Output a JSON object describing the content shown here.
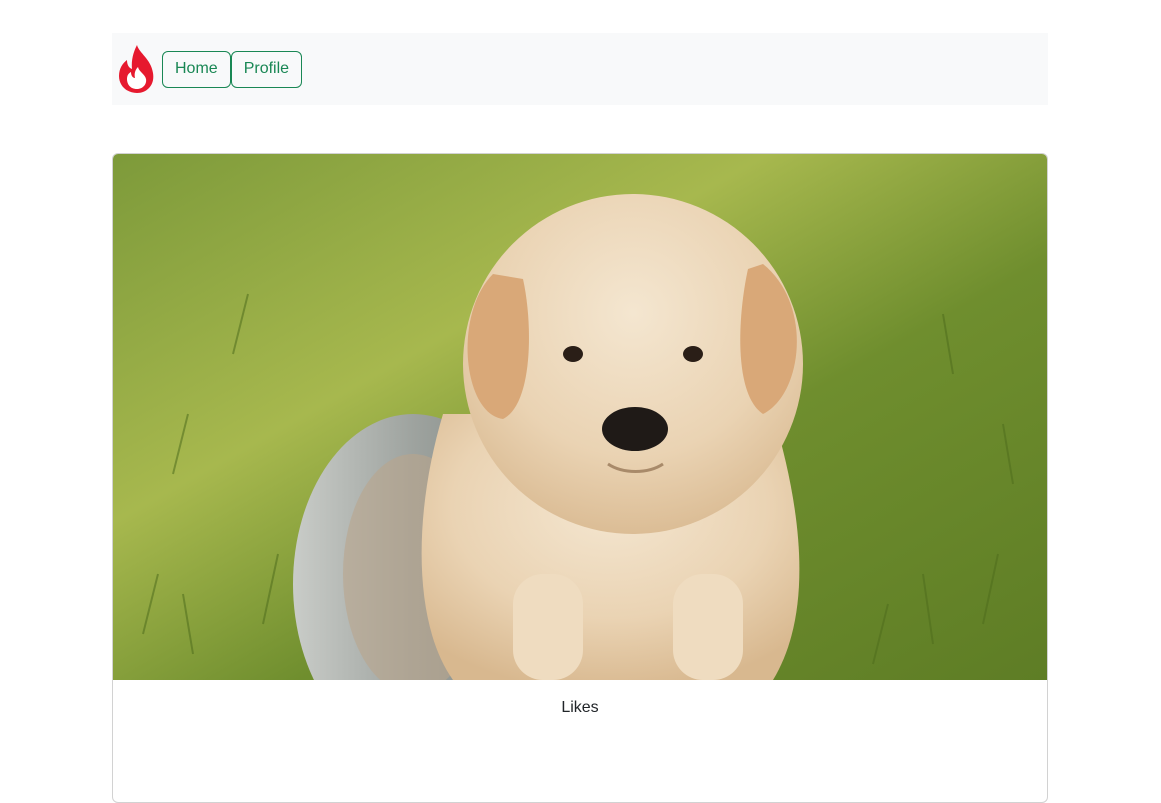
{
  "nav": {
    "logo_icon": "flame-icon",
    "brand_color": "#e6192e",
    "home_label": "Home",
    "profile_label": "Profile",
    "button_color": "#198754"
  },
  "card": {
    "image_subject": "puppy-photo",
    "likes_label": "Likes"
  }
}
